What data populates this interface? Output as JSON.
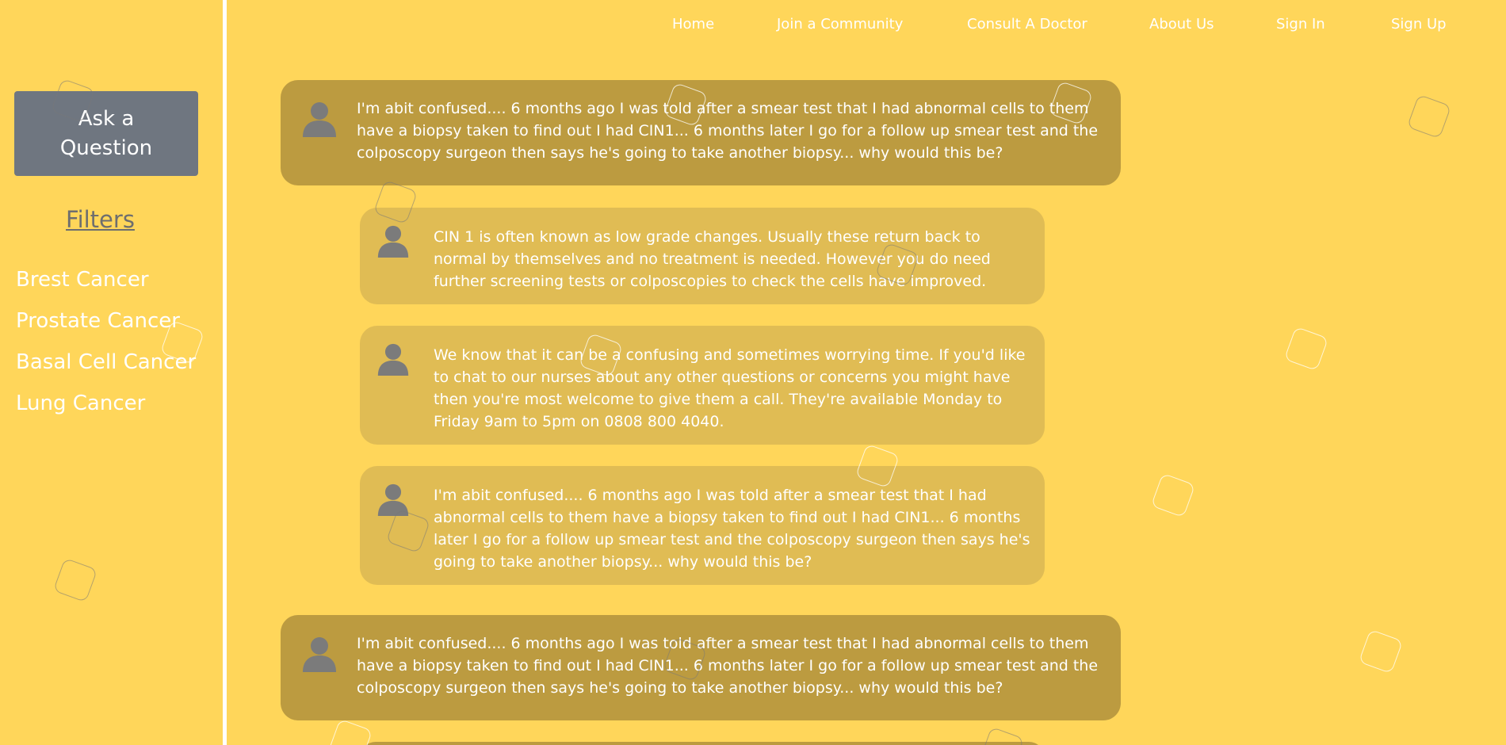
{
  "nav": {
    "items": [
      {
        "label": "Home"
      },
      {
        "label": "Join a Community"
      },
      {
        "label": "Consult A Doctor"
      },
      {
        "label": "About Us"
      },
      {
        "label": "Sign In"
      },
      {
        "label": "Sign Up"
      }
    ]
  },
  "sidebar": {
    "ask_button_label": "Ask a Question",
    "filters_title": "Filters",
    "filters": [
      {
        "label": "Brest Cancer"
      },
      {
        "label": "Prostate Cancer"
      },
      {
        "label": "Basal Cell Cancer"
      },
      {
        "label": "Lung Cancer"
      }
    ]
  },
  "posts": [
    {
      "kind": "question",
      "avatar_icon": "user-avatar-icon",
      "text": "I'm abit confused.... 6 months ago I was told after a smear test that I had abnormal cells to them have a biopsy taken to find out I had CIN1... 6 months later I go for a follow up smear test and the colposcopy surgeon then says he's going to take another biopsy... why would this be?"
    },
    {
      "kind": "reply",
      "avatar_icon": "user-avatar-icon",
      "text": "CIN 1 is often known as low grade changes. Usually these return back to normal by themselves and no treatment is needed. However you do need further screening tests or colposcopies to check the cells have improved."
    },
    {
      "kind": "reply",
      "avatar_icon": "user-avatar-icon",
      "text": "We know that it can be a confusing and sometimes worrying time. If you'd like to chat to our nurses about any other questions or concerns you might have then you're most welcome to give them a call. They're available Monday to Friday 9am to 5pm on 0808 800 4040."
    },
    {
      "kind": "reply",
      "avatar_icon": "user-avatar-icon",
      "text": "I'm abit confused.... 6 months ago I was told after a smear test that I had abnormal cells to them have a biopsy taken to find out I had CIN1... 6 months later I go for a follow up smear test and the colposcopy surgeon then says he's going to take another biopsy... why would this be?"
    },
    {
      "kind": "question",
      "avatar_icon": "user-avatar-icon",
      "text": "I'm abit confused.... 6 months ago I was told after a smear test that I had abnormal cells to them have a biopsy taken to find out I had CIN1... 6 months later I go for a follow up smear test and the colposcopy surgeon then says he's going to take another biopsy... why would this be?"
    }
  ],
  "colors": {
    "background": "#ffd65a",
    "question_card": "#bc9b40",
    "reply_card": "#e0bc54",
    "ask_button": "#6f7680",
    "avatar": "#7b7b7b"
  }
}
